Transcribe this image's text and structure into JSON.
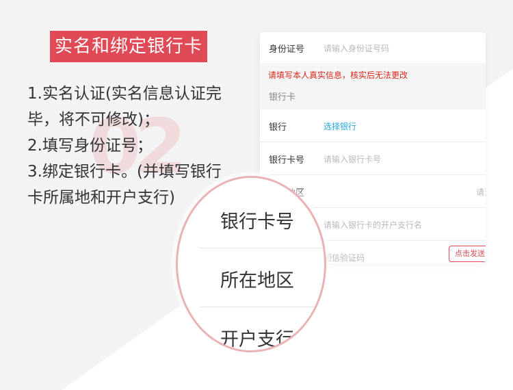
{
  "title": "实名和绑定银行卡",
  "steps": [
    "1.实名认证(实名信息认证完",
    "毕，将不可修改)；",
    "2.填写身份证号；",
    "3.绑定银行卡。(并填写银行",
    "卡所属地和开户支行)"
  ],
  "watermark": "02",
  "form": {
    "id_label": "身份证号",
    "id_placeholder": "请输入身份证号码",
    "notice": "请填写本人真实信息，核实后无法更改",
    "bank_card_section": "银行卡",
    "bank_label": "银行",
    "bank_value": "选择银行",
    "card_label": "银行卡号",
    "card_placeholder": "请输入银行卡号",
    "region_label": "所在地区",
    "region_value": "请选",
    "branch_placeholder": "请输入银行卡的开户支行名",
    "sms_placeholder": "短信验证码",
    "send_button": "点击发送"
  },
  "magnifier": {
    "item1": "银行卡号",
    "item2": "所在地区",
    "item3": "开户支行"
  },
  "colors": {
    "accent": "#e04a56",
    "notice_red": "#d9261c",
    "link_blue": "#2aa7e0"
  }
}
